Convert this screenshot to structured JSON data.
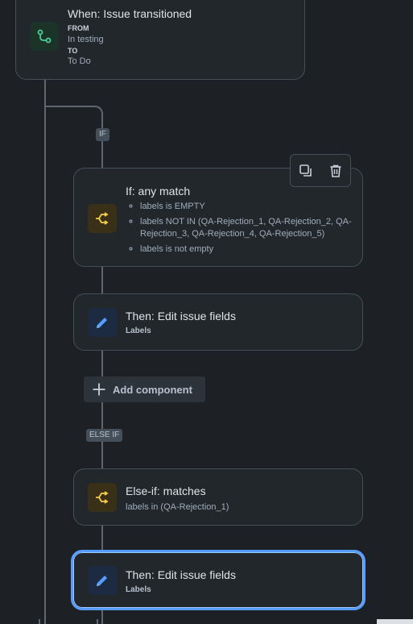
{
  "trigger": {
    "title": "When: Issue transitioned",
    "from_label": "FROM",
    "from_value": "In testing",
    "to_label": "TO",
    "to_value": "To Do",
    "icon": "transition-icon"
  },
  "branch_pills": {
    "if": "IF",
    "else_if": "ELSE IF"
  },
  "condition_if": {
    "title": "If: any match",
    "items": [
      "labels is EMPTY",
      "labels NOT IN (QA-Rejection_1, QA-Rejection_2, QA-Rejection_3, QA-Rejection_4, QA-Rejection_5)",
      "labels is not empty"
    ],
    "icon": "branch-icon"
  },
  "toolbar": {
    "duplicate_icon": "duplicate-icon",
    "delete_icon": "trash-icon"
  },
  "action_1": {
    "title": "Then: Edit issue fields",
    "subtitle": "Labels",
    "icon": "pencil-icon"
  },
  "add_component": {
    "label": "Add component",
    "icon": "plus-icon"
  },
  "condition_else_if": {
    "title": "Else-if: matches",
    "subtitle": "labels in (QA-Rejection_1)",
    "icon": "branch-icon"
  },
  "action_2": {
    "title": "Then: Edit issue fields",
    "subtitle": "Labels",
    "icon": "pencil-icon",
    "selected": true
  },
  "colors": {
    "background": "#1d2125",
    "card": "#22272b",
    "border": "#454f59",
    "selected_border": "#579dff",
    "green_icon": "#4bce97",
    "yellow_icon": "#f5cd47",
    "blue_icon": "#579dff"
  }
}
